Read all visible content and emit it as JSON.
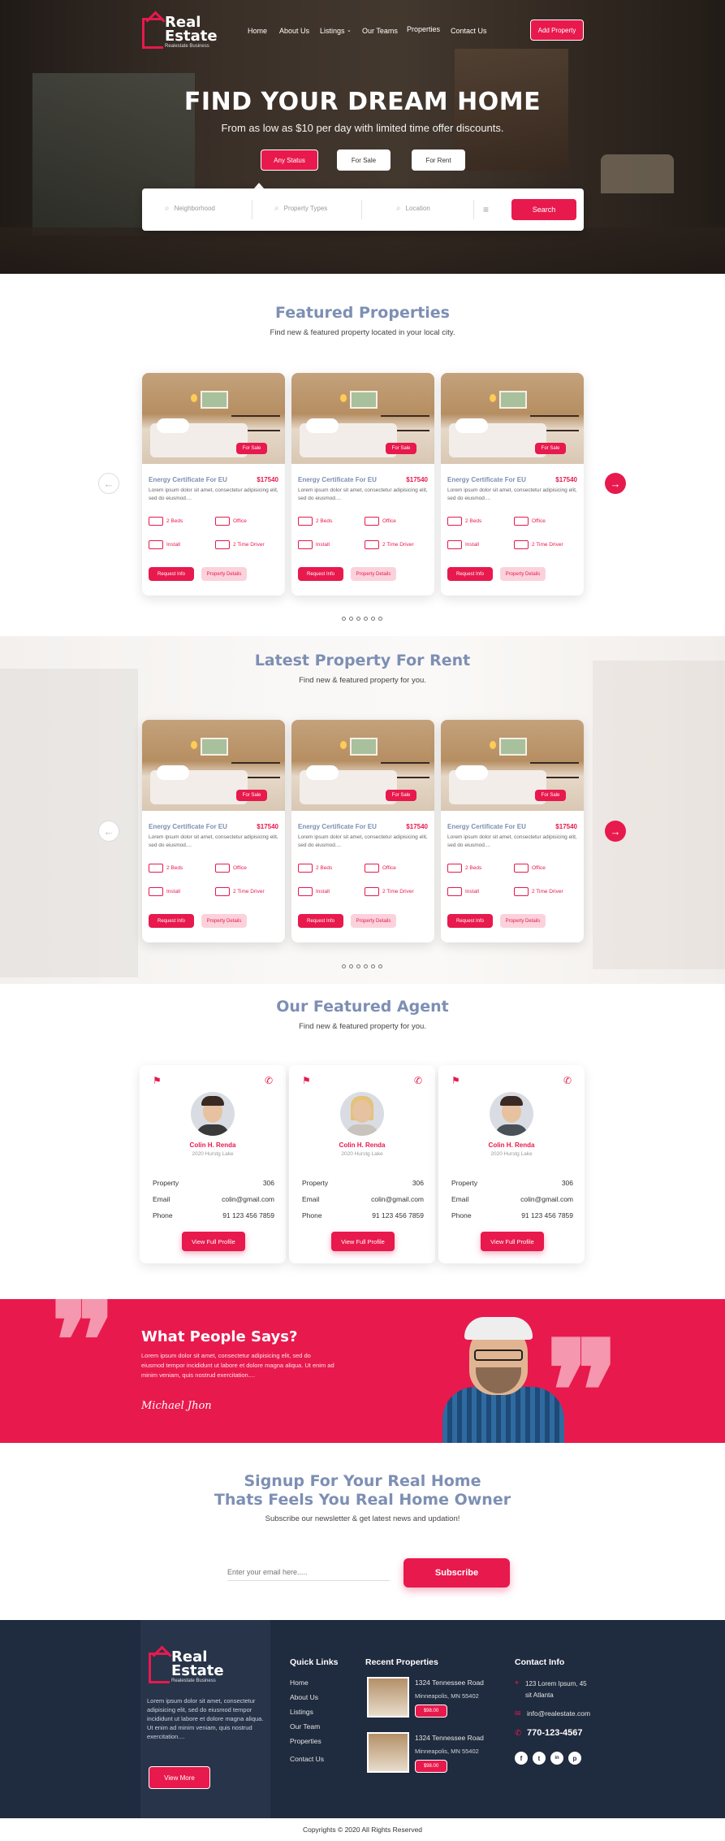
{
  "brand": {
    "name_line1": "Real",
    "name_line2": "Estate",
    "tagline": "Realestate Business"
  },
  "nav": {
    "items": [
      "Home",
      "About Us",
      "Listings",
      "Our Teams",
      "Properties",
      "Contact Us"
    ],
    "cta": "Add Property"
  },
  "hero": {
    "title": "FIND YOUR DREAM HOME",
    "subtitle": "From as low as $10 per day with limited time offer discounts.",
    "filters": [
      "Any Status",
      "For Sale",
      "For Rent"
    ],
    "search": {
      "neighborhood": "Neighborhood",
      "property_types": "Property Types",
      "location": "Location",
      "button": "Search"
    }
  },
  "featured": {
    "title": "Featured Properties",
    "subtitle": "Find new & featured property located in your local city."
  },
  "rent": {
    "title": "Latest Property For Rent",
    "subtitle": "Find new & featured property for you."
  },
  "property_card": {
    "tag": "For Sale",
    "title": "Energy Certificate For EU",
    "price": "$17540",
    "desc": "Lorem ipsum dolor sit amet, consectetur adipisicing elit, sed do eiusmod....",
    "beds": "2 Beds",
    "office": "Office",
    "install": "Install",
    "driver": "2 Time Driver",
    "btn_info": "Request Info",
    "btn_details": "Property Details"
  },
  "agents": {
    "title": "Our Featured Agent",
    "subtitle": "Find new & featured property for you.",
    "items": [
      {
        "name": "Colin H. Renda",
        "location": "2020 Hurstg Lake"
      },
      {
        "name": "Colin H. Renda",
        "location": "2020 Hurstg Lake"
      },
      {
        "name": "Colin H. Renda",
        "location": "2020 Hurstg Lake"
      }
    ],
    "property_label": "Property",
    "property_value": "306",
    "email_label": "Email",
    "email_value": "colin@gmail.com",
    "phone_label": "Phone",
    "phone_value": "91 123 456 7859",
    "button": "View Full Profile"
  },
  "testimonial": {
    "title": "What People Says?",
    "text": "Lorem ipsum dolor sit amet, consectetur adipisicing elit, sed do eiusmod tempor incididunt ut labore et dolore magna aliqua. Ut enim ad minim veniam, quis nostrud exercitation....",
    "signature": "Michael Jhon"
  },
  "signup": {
    "title_line1": "Signup For Your Real Home",
    "title_line2": "Thats Feels You Real Home Owner",
    "subtitle": "Subscribe our newsletter & get latest news and updation!",
    "placeholder": "Enter your email here.....",
    "button": "Subscribe"
  },
  "footer": {
    "about": "Lorem ipsum dolor sit amet, consectetur adipisicing elit, sed do eiusmod tempor incididunt ut labore et dolore magna aliqua. Ut enim ad minim veniam, quis nostrud exercitation....",
    "view_more": "View More",
    "quick_links_title": "Quick Links",
    "quick_links": [
      "Home",
      "About Us",
      "Listings",
      "Our Team",
      "Properties",
      "Contact Us"
    ],
    "recent_title": "Recent Properties",
    "recent": [
      {
        "address": "1324 Tennessee Road",
        "city": "Minneapolis, MN 55402",
        "price": "$98.00"
      },
      {
        "address": "1324 Tennessee Road",
        "city": "Minneapolis, MN 55402",
        "price": "$98.00"
      }
    ],
    "contact_title": "Contact Info",
    "contact_address": "123 Lorem Ipsum, 45 sit Atlanta",
    "contact_email": "info@realestate.com",
    "contact_phone": "770-123-4567",
    "social": [
      "f",
      "t",
      "in",
      "p"
    ],
    "copyright": "Copyrights © 2020 All Rights Reserved"
  },
  "colors": {
    "accent": "#e8194d",
    "heading": "#7d8fb3",
    "footer": "#1f2b3e"
  }
}
